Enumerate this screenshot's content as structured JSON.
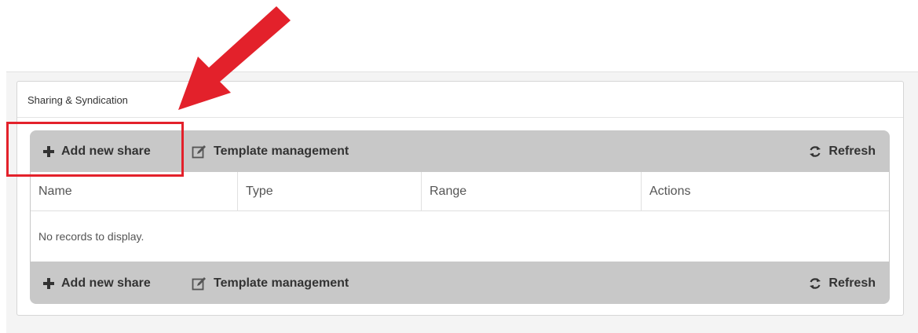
{
  "panel": {
    "title": "Sharing & Syndication"
  },
  "toolbar": {
    "add_label": "Add new share",
    "template_label": "Template management",
    "refresh_label": "Refresh"
  },
  "table": {
    "columns": [
      "Name",
      "Type",
      "Range",
      "Actions"
    ],
    "empty_message": "No records to display."
  },
  "annotations": {
    "arrow_color": "#e3212b",
    "highlight_color": "#e3212b"
  },
  "icons": {
    "add": "plus-icon",
    "template": "edit-icon",
    "refresh": "refresh-icon"
  }
}
